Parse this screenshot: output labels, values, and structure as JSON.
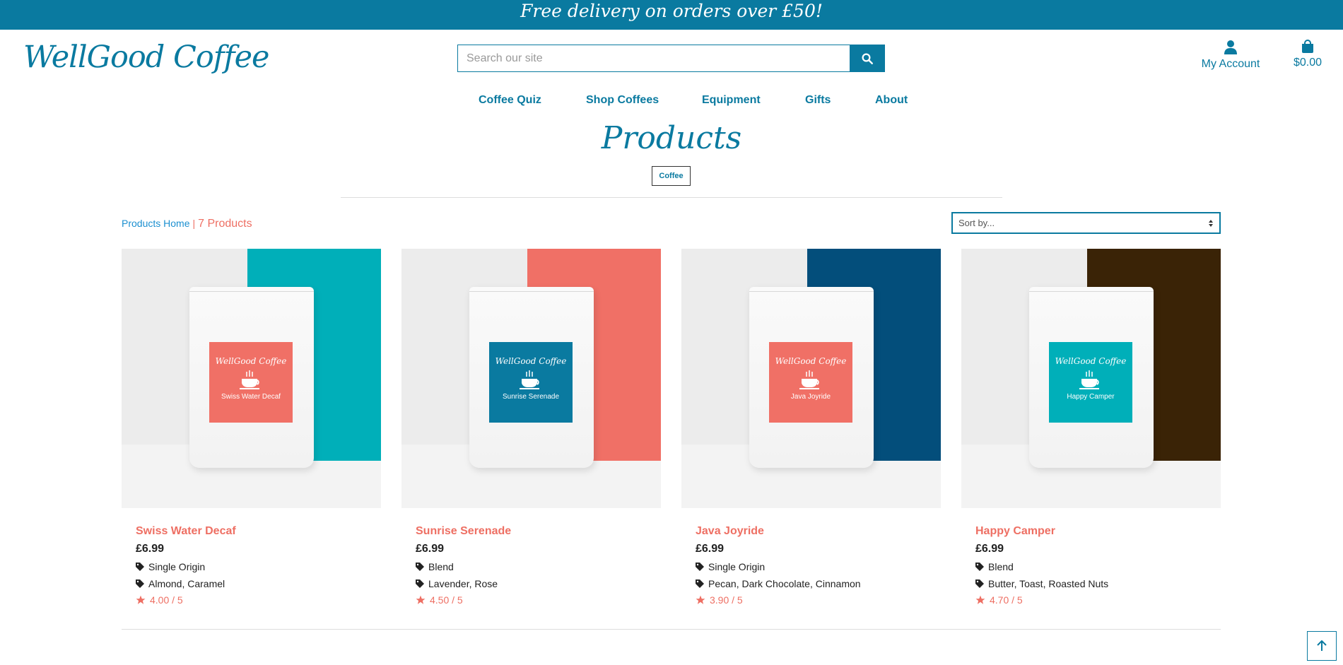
{
  "banner": {
    "text": "Free delivery on orders over £50!"
  },
  "header": {
    "logo": "WellGood Coffee",
    "search_placeholder": "Search our site",
    "account_label": "My Account",
    "cart_total": "$0.00"
  },
  "nav": [
    "Coffee Quiz",
    "Shop Coffees",
    "Equipment",
    "Gifts",
    "About"
  ],
  "page": {
    "title": "Products",
    "category_chip": "Coffee",
    "breadcrumb_home": "Products Home",
    "breadcrumb_sep": "|",
    "product_count": "7 Products",
    "sort_placeholder": "Sort by..."
  },
  "products": [
    {
      "name": "Swiss Water Decaf",
      "price": "£6.99",
      "type": "Single Origin",
      "notes": "Almond, Caramel",
      "rating": "4.00 / 5",
      "label_brand": "WellGood Coffee",
      "label_color": "#f07066",
      "panel_color": "#00afb9"
    },
    {
      "name": "Sunrise Serenade",
      "price": "£6.99",
      "type": "Blend",
      "notes": "Lavender, Rose",
      "rating": "4.50 / 5",
      "label_brand": "WellGood Coffee",
      "label_color": "#0a7aa0",
      "panel_color": "#f07066"
    },
    {
      "name": "Java Joyride",
      "price": "£6.99",
      "type": "Single Origin",
      "notes": "Pecan, Dark Chocolate, Cinnamon",
      "rating": "3.90 / 5",
      "label_brand": "WellGood Coffee",
      "label_color": "#f07066",
      "panel_color": "#034e7b"
    },
    {
      "name": "Happy Camper",
      "price": "£6.99",
      "type": "Blend",
      "notes": "Butter, Toast, Roasted Nuts",
      "rating": "4.70 / 5",
      "label_brand": "WellGood Coffee",
      "label_color": "#00afb9",
      "panel_color": "#3a2306"
    }
  ],
  "colors": {
    "brand": "#0a7aa0",
    "accent": "#ee6f63",
    "link": "#1b8fd0"
  }
}
